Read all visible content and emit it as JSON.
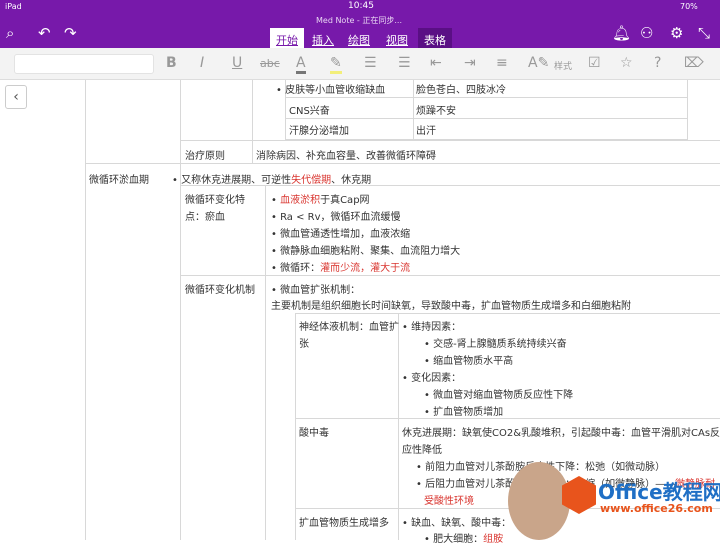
{
  "status": {
    "device": "iPad",
    "time": "10:45",
    "battery": "70%"
  },
  "title": "Med Note - 正在同步...",
  "tabs": [
    "开始",
    "插入",
    "绘图",
    "视图",
    "表格"
  ],
  "ribbon": {
    "style_label": "样式"
  },
  "table": {
    "r1": {
      "a": "皮肤等小血管收缩缺血",
      "b": "脸色苍白、四肢冰冷"
    },
    "r2": {
      "a": "CNS兴奋",
      "b": "烦躁不安"
    },
    "r3": {
      "a": "汗腺分泌增加",
      "b": "出汗"
    },
    "treat": {
      "label": "治疗原则",
      "text": "消除病因、补充血容量、改善微循环障碍"
    },
    "stage": {
      "label": "微循环淤血期",
      "intro_a": "又称休克进展期、可逆性",
      "intro_red": "失代偿期",
      "intro_b": "、休克期"
    },
    "feat": {
      "label1": "微循环变化特",
      "label2": "点：瘀血",
      "i1_red": "血液淤积",
      "i1": "于真Cap网",
      "i2": "Ra < Rv，微循环血流缓慢",
      "i3": "微血管通透性增加，血液浓缩",
      "i4": "微静脉血细胞粘附、聚集、血流阻力增大",
      "i5": "微循环：",
      "i5_red": "灌而少流，灌大于流"
    },
    "mech": {
      "label": "微循环变化机制",
      "title": "微血管扩张机制：",
      "desc": "主要机制是组织细胞长时间缺氧，导致酸中毒，扩血管物质生成增多和白细胞粘附",
      "n": {
        "label1": "神经体液机制：血管扩",
        "label2": "张",
        "m1": "维持因素：",
        "m1a": "交感-肾上腺髓质系统持续兴奋",
        "m1b": "缩血管物质水平高",
        "m2": "变化因素：",
        "m2a": "微血管对缩血管物质反应性下降",
        "m2b": "扩血管物质增加"
      },
      "acid": {
        "label": "酸中毒",
        "t1": "休克进展期：缺氧使CO2&乳酸堆积，引起酸中毒：血管平滑肌对CAs反",
        "t2": "应性降低",
        "a1": "前阻力血管对儿茶酚胺反应性下降：松弛（如微动脉）",
        "a2": "后阻力血管对儿茶酚胺保持反应：收缩（如微静脉）——",
        "a2_red": "微静脉耐",
        "a3_red": "受酸性环境"
      },
      "dil": {
        "label": "扩血管物质生成增多",
        "d1": "缺血、缺氧、酸中毒：",
        "d2": "肥大细胞：",
        "d2_red": "组胺"
      }
    }
  },
  "watermark": {
    "brand": "Office教程网",
    "url": "www.office26.com"
  }
}
